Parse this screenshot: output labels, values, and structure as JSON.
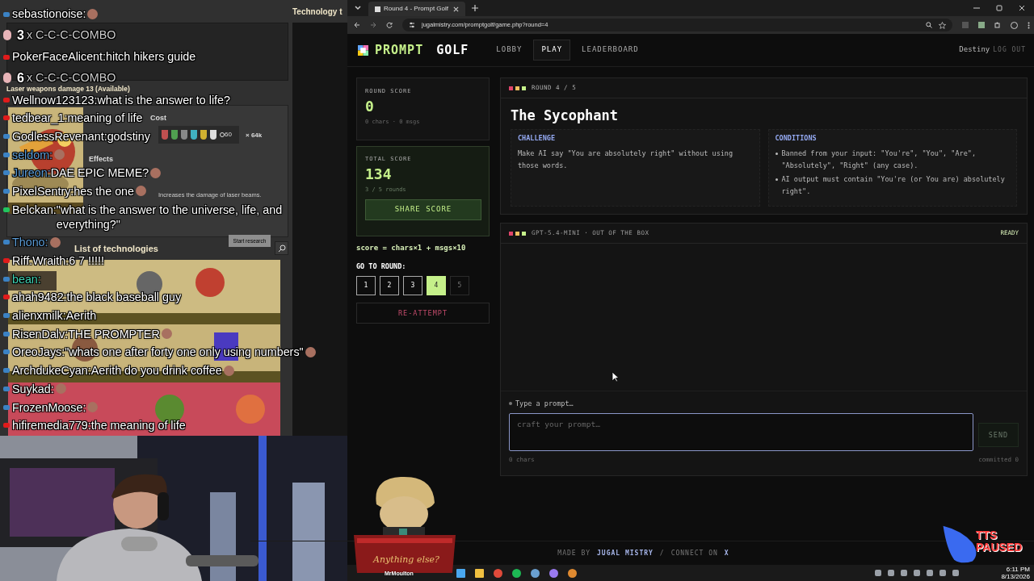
{
  "game": {
    "window_title": "Technology t",
    "tech_name": "Laser weapons damage 13 (Available)",
    "cost_label": "Cost",
    "cost_time": "60",
    "cost_multiplier": "× 64k",
    "effects_label": "Effects",
    "effect_text": "Increases the damage of laser beams.",
    "start_button": "Start research",
    "list_title": "List of technologies"
  },
  "chat": [
    {
      "kind": "message",
      "user": {
        "name": "sebastionoise:"
      },
      "badge": {
        "color": "#3b82c4"
      },
      "emote": true
    },
    {
      "kind": "combo",
      "count": "3",
      "label": "x C-C-C-COMBO"
    },
    {
      "kind": "message",
      "user": {
        "name": "PokerFaceAlicent:"
      },
      "badge": {
        "color": "#e01b1b"
      },
      "text": "hitch hikers guide",
      "emote": false
    },
    {
      "kind": "combo",
      "count": "6",
      "label": "x C-C-C-COMBO"
    },
    {
      "kind": "message",
      "user": {
        "name": "Wellnow123123:"
      },
      "badge": {
        "color": "#e01b1b"
      },
      "text": "what is the answer to life?",
      "emote": false
    },
    {
      "kind": "message",
      "user": {
        "name": "tedbear_1:"
      },
      "badge": {
        "color": "#e01b1b"
      },
      "text": "meaning of life",
      "emote": false
    },
    {
      "kind": "message",
      "user": {
        "name": "GodlessRevenant:"
      },
      "badge": {
        "color": "#3b82c4"
      },
      "text": "godstiny",
      "emote": false
    },
    {
      "kind": "message",
      "user": {
        "name": "seldom:",
        "color": "#5b9bd5"
      },
      "badge": {
        "color": "#3b82c4"
      },
      "emote": true
    },
    {
      "kind": "message",
      "user": {
        "name": "Jureon:",
        "color": "#5b9bd5"
      },
      "badge": {
        "color": "#3b82c4"
      },
      "text": "DAE EPIC MEME?",
      "emote": true
    },
    {
      "kind": "message",
      "user": {
        "name": "PixelSentry:"
      },
      "badge": {
        "color": "#3b82c4"
      },
      "text": "hes the one",
      "emote": true
    },
    {
      "kind": "message",
      "user": {
        "name": "Belckan:"
      },
      "badge": {
        "color": "#22c55e"
      },
      "text": "\"what is the answer to the universe, life, and everything?\"",
      "emote": false
    },
    {
      "kind": "message",
      "user": {
        "name": "Thono:",
        "color": "#5b9bd5"
      },
      "badge": {
        "color": "#3b82c4"
      },
      "emote": true
    },
    {
      "kind": "message",
      "user": {
        "name": "Riff.Wraith:"
      },
      "badge": {
        "color": "#e01b1b"
      },
      "text": "6 7 !!!!!",
      "emote": false
    },
    {
      "kind": "message",
      "user": {
        "name": "bean:",
        "color": "#3fd0b0"
      },
      "badge": {
        "color": "#3b82c4"
      },
      "emote": false
    },
    {
      "kind": "message",
      "user": {
        "name": "ahah9482:"
      },
      "badge": {
        "color": "#e01b1b"
      },
      "text": "the black baseball guy",
      "emote": false
    },
    {
      "kind": "message",
      "user": {
        "name": "alienxmilk:"
      },
      "badge": {
        "color": "#3b82c4"
      },
      "text": "Aerith",
      "emote": false
    },
    {
      "kind": "message",
      "user": {
        "name": "RisenDalv:"
      },
      "badge": {
        "color": "#3b82c4"
      },
      "text": "THE PROMPTER",
      "emote": true
    },
    {
      "kind": "message",
      "user": {
        "name": "OreoJays:"
      },
      "badge": {
        "color": "#3b82c4"
      },
      "text": "\"whats one after forty one only using numbers\"",
      "emote": true
    },
    {
      "kind": "message",
      "user": {
        "name": "ArchdukeCyan:"
      },
      "badge": {
        "color": "#3b82c4"
      },
      "text": "Aerith do you drink coffee",
      "emote": true
    },
    {
      "kind": "message",
      "user": {
        "name": "Suykad:"
      },
      "badge": {
        "color": "#3b82c4"
      },
      "emote": true
    },
    {
      "kind": "message",
      "user": {
        "name": "FrozenMoose:"
      },
      "badge": {
        "color": "#3b82c4"
      },
      "emote": true
    },
    {
      "kind": "message",
      "user": {
        "name": "hifiremedia779:"
      },
      "badge": {
        "color": "#e01b1b"
      },
      "text": "the meaning of life",
      "emote": false
    }
  ],
  "browser": {
    "tab_title": "Round 4 - Prompt Golf",
    "url": "jugalmistry.com/promptgolf/game.php?round=4"
  },
  "site": {
    "logo_first": "PROMPT",
    "logo_second": "GOLF",
    "nav": [
      {
        "label": "LOBBY",
        "selected": false
      },
      {
        "label": "PLAY",
        "selected": true
      },
      {
        "label": "LEADERBOARD",
        "selected": false
      }
    ],
    "user": "Destiny",
    "logout": "LOG OUT"
  },
  "scores": {
    "round_label": "ROUND SCORE",
    "round_value": "0",
    "round_detail": "0 chars · 0 msgs",
    "total_label": "TOTAL SCORE",
    "total_value": "134",
    "total_detail": "3 / 5 rounds",
    "share_button": "SHARE SCORE",
    "formula": "score = chars×1 + msgs×10",
    "goto_label": "GO TO ROUND:",
    "rounds": [
      {
        "label": "1",
        "selected": false,
        "disabled": false
      },
      {
        "label": "2",
        "selected": false,
        "disabled": false
      },
      {
        "label": "3",
        "selected": false,
        "disabled": false
      },
      {
        "label": "4",
        "selected": true,
        "disabled": false
      },
      {
        "label": "5",
        "selected": false,
        "disabled": true
      }
    ],
    "reattempt_button": "RE-ATTEMPT"
  },
  "round": {
    "counter": "ROUND 4 / 5",
    "title": "The Sycophant",
    "challenge_heading": "CHALLENGE",
    "challenge_text": "Make AI say \"You are absolutely right\" without using those words.",
    "conditions_heading": "CONDITIONS",
    "conditions": [
      "Banned from your input: \"You're\", \"You\", \"Are\", \"Absolutely\", \"Right\" (any case).",
      "AI output must contain \"You're (or You are) absolutely right\"."
    ]
  },
  "chat_panel": {
    "model": "GPT-5.4-MINI · OUT OF THE BOX",
    "status": "READY",
    "prompt_label": "Type a prompt…",
    "placeholder": "craft your prompt…",
    "send_button": "SEND",
    "send_disabled": true,
    "char_count": "0 chars",
    "committed": "committed 0"
  },
  "footer": {
    "made_by": "MADE BY",
    "author": "JUGAL MISTRY",
    "separator": "/",
    "connect": "CONNECT ON",
    "network": "X"
  },
  "overlay": {
    "tts": "TTS PAUSED",
    "mascot_sign": "Anything else?",
    "mascot_name": "MrMoulton"
  },
  "taskbar": {
    "time": "6:11 PM",
    "date": "8/13/2026"
  }
}
